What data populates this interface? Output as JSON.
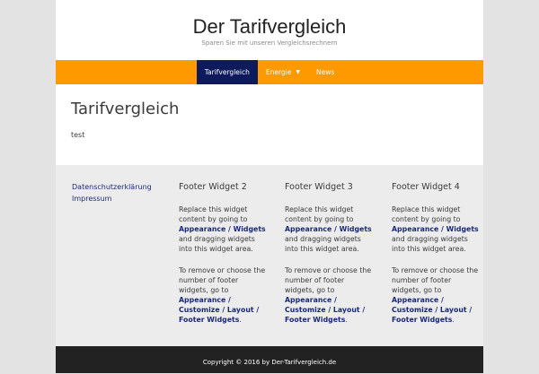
{
  "header": {
    "site_title": "Der Tarifvergleich",
    "tagline": "Sparen Sie mit unseren Vergleichsrechnern"
  },
  "nav": {
    "items": [
      {
        "label": "Tarifvergleich",
        "active": true
      },
      {
        "label": "Energie",
        "has_dropdown": true
      },
      {
        "label": "News"
      }
    ]
  },
  "content": {
    "title": "Tarifvergleich",
    "text": "test"
  },
  "footer": {
    "links": [
      "Datenschutzerklärung",
      "Impressum"
    ],
    "widgets": [
      {
        "title": "Footer Widget 2",
        "p1_a": "Replace this widget content by going to ",
        "p1_link": "Appearance / Widgets",
        "p1_b": " and dragging widgets into this widget area.",
        "p2_a": "To remove or choose the number of footer widgets, go to ",
        "p2_link": "Appearance / Customize / Layout / Footer Widgets",
        "p2_b": "."
      },
      {
        "title": "Footer Widget 3",
        "p1_a": "Replace this widget content by going to ",
        "p1_link": "Appearance / Widgets",
        "p1_b": " and dragging widgets into this widget area.",
        "p2_a": "To remove or choose the number of footer widgets, go to ",
        "p2_link": "Appearance / Customize / Layout / Footer Widgets",
        "p2_b": "."
      },
      {
        "title": "Footer Widget 4",
        "p1_a": "Replace this widget content by going to ",
        "p1_link": "Appearance / Widgets",
        "p1_b": " and dragging widgets into this widget area.",
        "p2_a": "To remove or choose the number of footer widgets, go to ",
        "p2_link": "Appearance / Customize / Layout / Footer Widgets",
        "p2_b": "."
      }
    ],
    "copyright": "Copyright © 2016 by Der-Tarifvergleich.de"
  },
  "colors": {
    "accent": "#ff9900",
    "nav_active": "#0d1a5c",
    "link": "#1b2a78",
    "footer_bar": "#222222"
  }
}
